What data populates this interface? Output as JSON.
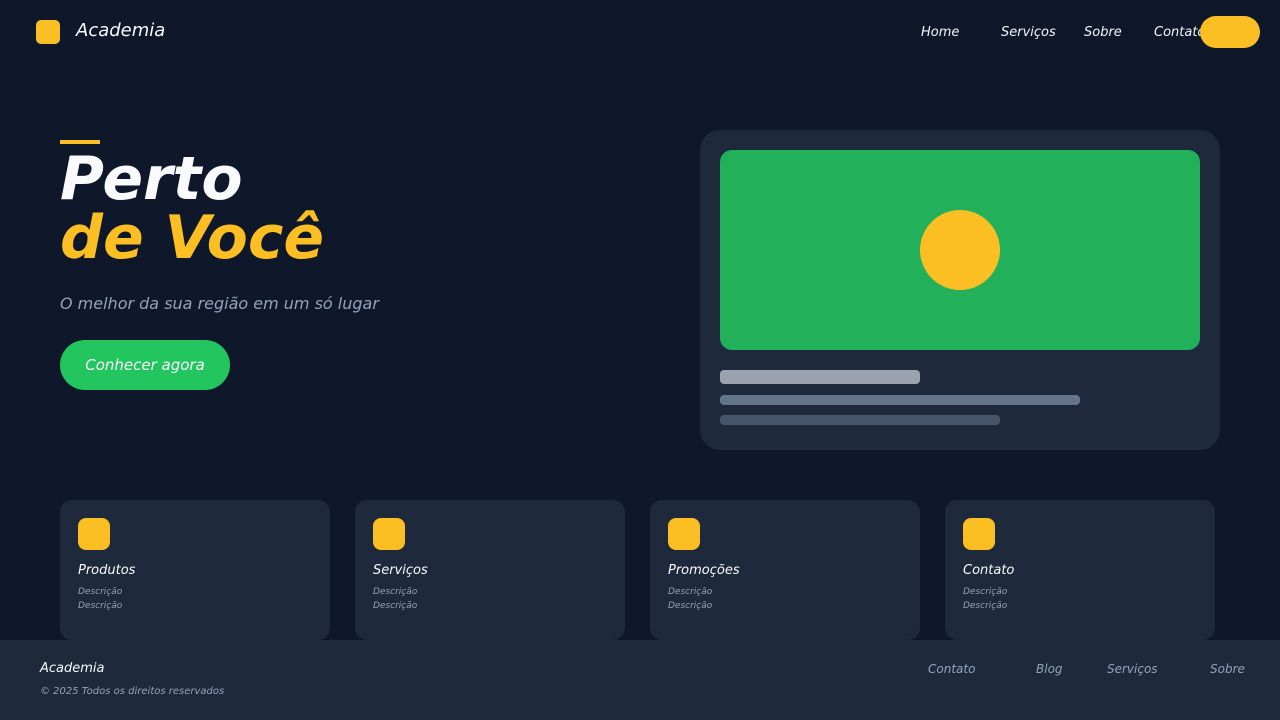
{
  "nav": {
    "brand": "Academia",
    "links": [
      "Home",
      "Serviços",
      "Sobre",
      "Contato"
    ]
  },
  "hero": {
    "title_line1": "Perto",
    "title_line2": "de Você",
    "subtitle": "O melhor da sua região em um só lugar",
    "cta": "Conhecer agora"
  },
  "cards": [
    {
      "title": "Produtos",
      "desc": [
        "Descrição",
        "Descrição"
      ]
    },
    {
      "title": "Serviços",
      "desc": [
        "Descrição",
        "Descrição"
      ]
    },
    {
      "title": "Promoções",
      "desc": [
        "Descrição",
        "Descrição"
      ]
    },
    {
      "title": "Contato",
      "desc": [
        "Descrição",
        "Descrição"
      ]
    }
  ],
  "footer": {
    "brand": "Academia",
    "copyright": "© 2025 Todos os direitos reservados",
    "links": [
      "Contato",
      "Blog",
      "Serviços",
      "Sobre"
    ]
  },
  "colors": {
    "background": "#0f172a",
    "surface": "#1e293b",
    "accent": "#fbbf24",
    "primary": "#22c55e"
  }
}
